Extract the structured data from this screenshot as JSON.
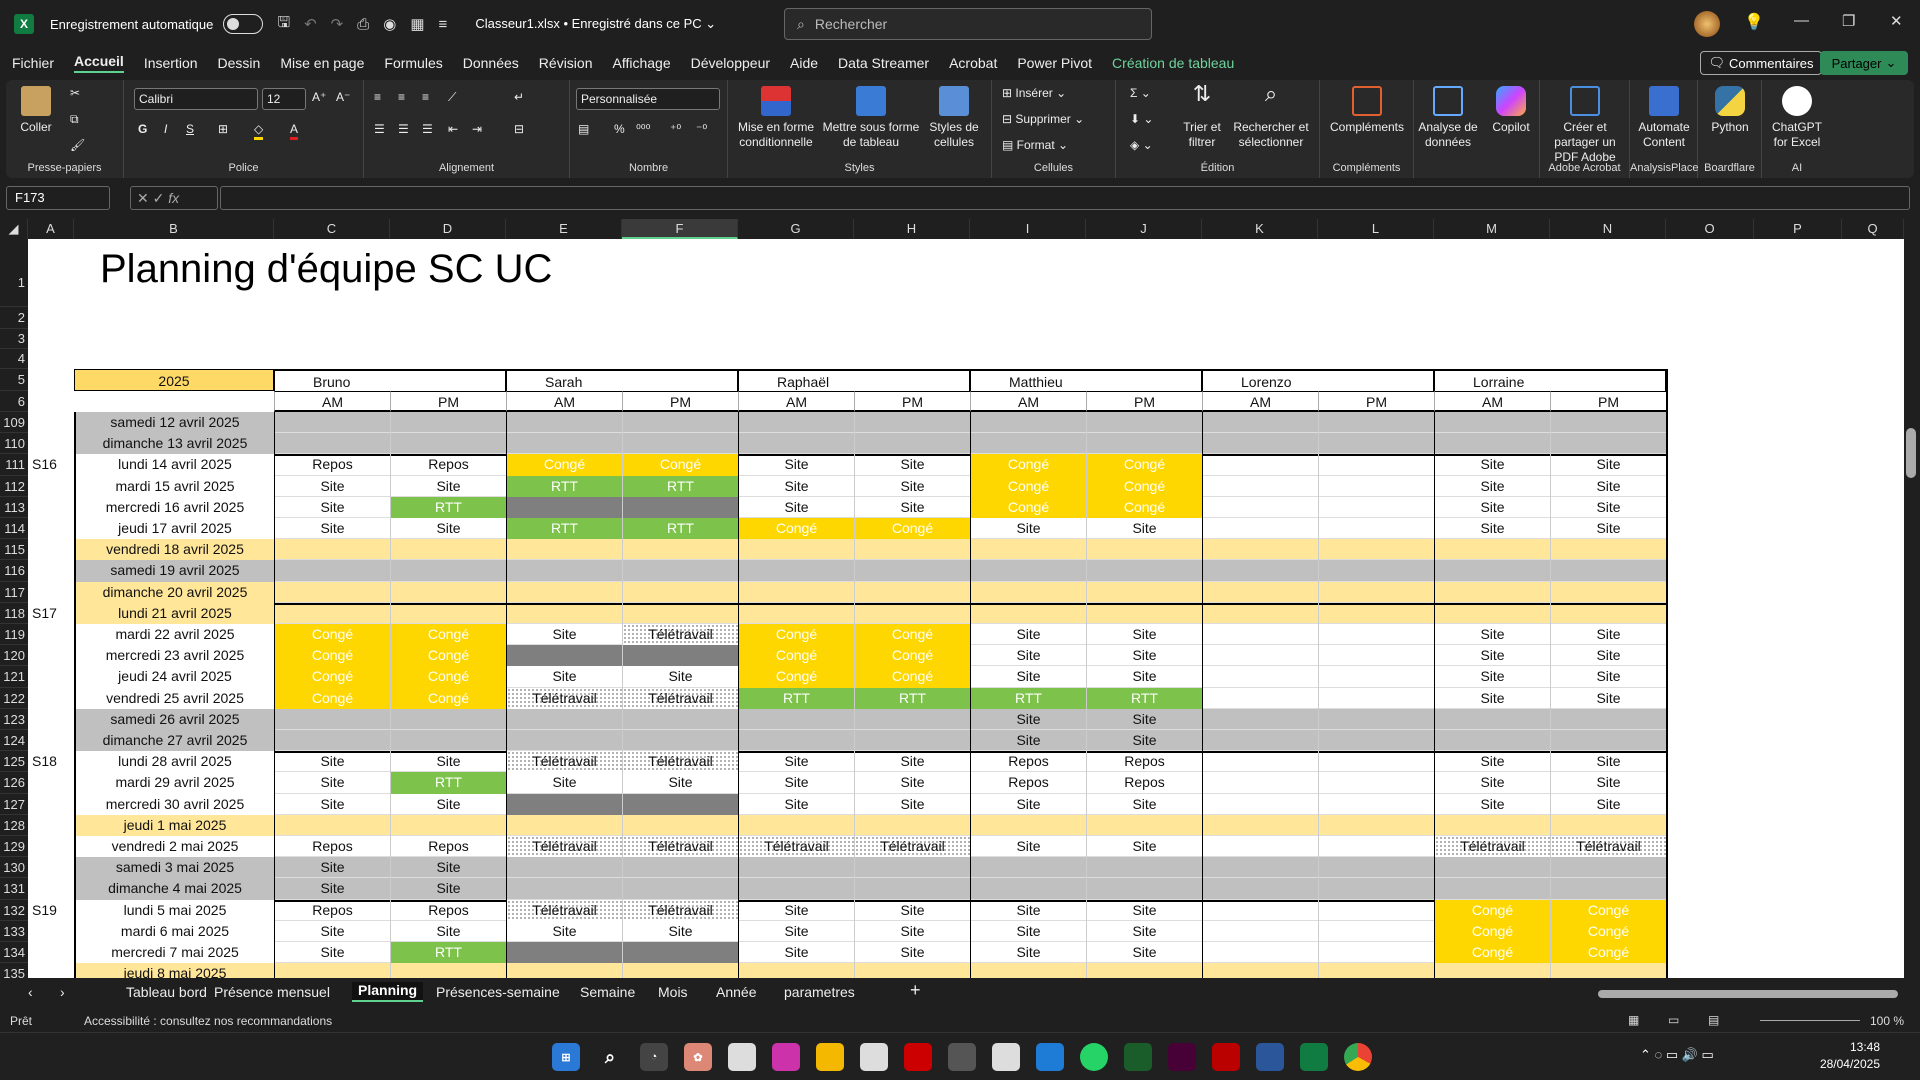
{
  "titlebar": {
    "app_icon": "X",
    "autosave_label": "Enregistrement automatique",
    "filename": "Classeur1.xlsx • Enregistré dans ce PC ⌄",
    "search_placeholder": "Rechercher"
  },
  "menu": [
    {
      "label": "Fichier"
    },
    {
      "label": "Accueil"
    },
    {
      "label": "Insertion"
    },
    {
      "label": "Dessin"
    },
    {
      "label": "Mise en page"
    },
    {
      "label": "Formules"
    },
    {
      "label": "Données"
    },
    {
      "label": "Révision"
    },
    {
      "label": "Affichage"
    },
    {
      "label": "Développeur"
    },
    {
      "label": "Aide"
    },
    {
      "label": "Data Streamer"
    },
    {
      "label": "Acrobat"
    },
    {
      "label": "Power Pivot"
    },
    {
      "label": "Création de tableau"
    }
  ],
  "header_buttons": {
    "comments": "Commentaires",
    "share": "Partager"
  },
  "ribbon": {
    "paste": "Coller",
    "font_name": "Calibri",
    "font_size": "12",
    "number_format": "Personnalisée",
    "groups": {
      "clipboard": "Presse-papiers",
      "font": "Police",
      "alignment": "Alignement",
      "number": "Nombre",
      "styles": "Styles",
      "cells": "Cellules",
      "editing": "Édition",
      "addins": "Compléments",
      "acrobat": "Adobe Acrobat",
      "analysisplace": "AnalysisPlace",
      "boardflare": "Boardflare",
      "ai": "AI"
    },
    "buttons": {
      "cond_format": "Mise en forme conditionnelle",
      "format_table": "Mettre sous forme de tableau",
      "cell_styles": "Styles de cellules",
      "insert": "Insérer",
      "delete": "Supprimer",
      "format": "Format",
      "sort_filter": "Trier et filtrer",
      "find_select": "Rechercher et sélectionner",
      "addins": "Compléments",
      "analyze": "Analyse de données",
      "copilot": "Copilot",
      "create_pdf": "Créer et partager un PDF Adobe",
      "automate": "Automate Content",
      "python": "Python",
      "chatgpt": "ChatGPT for Excel"
    }
  },
  "formula_bar": {
    "name_box": "F173",
    "fx": "fx",
    "content": ""
  },
  "columns": [
    "A",
    "B",
    "C",
    "D",
    "E",
    "F",
    "G",
    "H",
    "I",
    "J",
    "K",
    "L",
    "M",
    "N",
    "O",
    "P",
    "Q"
  ],
  "sheet": {
    "title": "Planning d'équipe SC   UC",
    "year": "2025",
    "people": [
      "Bruno",
      "Sarah",
      "Raphaël",
      "Matthieu",
      "Lorenzo",
      "Lorraine"
    ],
    "am": "AM",
    "pm": "PM",
    "rows": [
      {
        "n": "109",
        "wk": "",
        "day": "samedi 12 avril 2025",
        "t": "W",
        "c": []
      },
      {
        "n": "110",
        "wk": "",
        "day": "dimanche 13 avril 2025",
        "t": "W",
        "c": []
      },
      {
        "n": "111",
        "wk": "S16",
        "day": "lundi 14 avril 2025",
        "t": "N",
        "c": [
          "Repos",
          "Repos",
          "Congé",
          "Congé",
          "Site",
          "Site",
          "Congé",
          "Congé",
          "",
          "",
          "Site",
          "Site"
        ]
      },
      {
        "n": "112",
        "wk": "",
        "day": "mardi 15 avril 2025",
        "t": "N",
        "c": [
          "Site",
          "Site",
          "RTT",
          "RTT",
          "Site",
          "Site",
          "Congé",
          "Congé",
          "",
          "",
          "Site",
          "Site"
        ]
      },
      {
        "n": "113",
        "wk": "",
        "day": "mercredi 16 avril 2025",
        "t": "N",
        "c": [
          "Site",
          "RTT",
          "X",
          "X",
          "Site",
          "Site",
          "Congé",
          "Congé",
          "",
          "",
          "Site",
          "Site"
        ]
      },
      {
        "n": "114",
        "wk": "",
        "day": "jeudi 17 avril 2025",
        "t": "N",
        "c": [
          "Site",
          "Site",
          "RTT",
          "RTT",
          "Congé",
          "Congé",
          "Site",
          "Site",
          "",
          "",
          "Site",
          "Site"
        ]
      },
      {
        "n": "115",
        "wk": "",
        "day": "vendredi 18 avril 2025",
        "t": "H",
        "c": []
      },
      {
        "n": "116",
        "wk": "",
        "day": "samedi 19 avril 2025",
        "t": "W",
        "c": []
      },
      {
        "n": "117",
        "wk": "",
        "day": "dimanche 20 avril 2025",
        "t": "H",
        "c": []
      },
      {
        "n": "118",
        "wk": "S17",
        "day": "lundi 21 avril 2025",
        "t": "H",
        "c": []
      },
      {
        "n": "119",
        "wk": "",
        "day": "mardi 22 avril 2025",
        "t": "N",
        "c": [
          "Congé",
          "Congé",
          "Site",
          "Télétravail",
          "Congé",
          "Congé",
          "Site",
          "Site",
          "",
          "",
          "Site",
          "Site"
        ]
      },
      {
        "n": "120",
        "wk": "",
        "day": "mercredi 23 avril 2025",
        "t": "N",
        "c": [
          "Congé",
          "Congé",
          "X",
          "X",
          "Congé",
          "Congé",
          "Site",
          "Site",
          "",
          "",
          "Site",
          "Site"
        ]
      },
      {
        "n": "121",
        "wk": "",
        "day": "jeudi 24 avril 2025",
        "t": "N",
        "c": [
          "Congé",
          "Congé",
          "Site",
          "Site",
          "Congé",
          "Congé",
          "Site",
          "Site",
          "",
          "",
          "Site",
          "Site"
        ]
      },
      {
        "n": "122",
        "wk": "",
        "day": "vendredi 25 avril 2025",
        "t": "N",
        "c": [
          "Congé",
          "Congé",
          "Télétravail",
          "Télétravail",
          "RTT",
          "RTT",
          "RTT",
          "RTT",
          "",
          "",
          "Site",
          "Site"
        ]
      },
      {
        "n": "123",
        "wk": "",
        "day": "samedi 26 avril 2025",
        "t": "W",
        "c": [
          "",
          "",
          "",
          "",
          "",
          "",
          "Site",
          "Site",
          "",
          "",
          "",
          ""
        ]
      },
      {
        "n": "124",
        "wk": "",
        "day": "dimanche 27 avril 2025",
        "t": "W",
        "c": [
          "",
          "",
          "",
          "",
          "",
          "",
          "Site",
          "Site",
          "",
          "",
          "",
          ""
        ]
      },
      {
        "n": "125",
        "wk": "S18",
        "day": "lundi 28 avril 2025",
        "t": "N",
        "c": [
          "Site",
          "Site",
          "Télétravail",
          "Télétravail",
          "Site",
          "Site",
          "Repos",
          "Repos",
          "",
          "",
          "Site",
          "Site"
        ]
      },
      {
        "n": "126",
        "wk": "",
        "day": "mardi 29 avril 2025",
        "t": "N",
        "c": [
          "Site",
          "RTT",
          "Site",
          "Site",
          "Site",
          "Site",
          "Repos",
          "Repos",
          "",
          "",
          "Site",
          "Site"
        ]
      },
      {
        "n": "127",
        "wk": "",
        "day": "mercredi 30 avril 2025",
        "t": "N",
        "c": [
          "Site",
          "Site",
          "X",
          "X",
          "Site",
          "Site",
          "Site",
          "Site",
          "",
          "",
          "Site",
          "Site"
        ]
      },
      {
        "n": "128",
        "wk": "",
        "day": "jeudi 1 mai 2025",
        "t": "H",
        "c": []
      },
      {
        "n": "129",
        "wk": "",
        "day": "vendredi 2 mai 2025",
        "t": "N",
        "c": [
          "Repos",
          "Repos",
          "Télétravail",
          "Télétravail",
          "Télétravail",
          "Télétravail",
          "Site",
          "Site",
          "",
          "",
          "Télétravail",
          "Télétravail"
        ]
      },
      {
        "n": "130",
        "wk": "",
        "day": "samedi 3 mai 2025",
        "t": "W",
        "c": [
          "Site",
          "Site",
          "",
          "",
          "",
          "",
          "",
          "",
          "",
          "",
          "",
          ""
        ]
      },
      {
        "n": "131",
        "wk": "",
        "day": "dimanche 4 mai 2025",
        "t": "W",
        "c": [
          "Site",
          "Site",
          "",
          "",
          "",
          "",
          "",
          "",
          "",
          "",
          "",
          ""
        ]
      },
      {
        "n": "132",
        "wk": "S19",
        "day": "lundi 5 mai 2025",
        "t": "N",
        "c": [
          "Repos",
          "Repos",
          "Télétravail",
          "Télétravail",
          "Site",
          "Site",
          "Site",
          "Site",
          "",
          "",
          "Congé",
          "Congé"
        ]
      },
      {
        "n": "133",
        "wk": "",
        "day": "mardi 6 mai 2025",
        "t": "N",
        "c": [
          "Site",
          "Site",
          "Site",
          "Site",
          "Site",
          "Site",
          "Site",
          "Site",
          "",
          "",
          "Congé",
          "Congé"
        ]
      },
      {
        "n": "134",
        "wk": "",
        "day": "mercredi 7 mai 2025",
        "t": "N",
        "c": [
          "Site",
          "RTT",
          "X",
          "X",
          "Site",
          "Site",
          "Site",
          "Site",
          "",
          "",
          "Congé",
          "Congé"
        ]
      },
      {
        "n": "135",
        "wk": "",
        "day": "jeudi 8 mai 2025",
        "t": "H",
        "c": []
      }
    ]
  },
  "sheet_tabs": [
    "Tableau bord",
    "Présence mensuel",
    "Planning",
    "Présences-semaine",
    "Semaine",
    "Mois",
    "Année",
    "parametres"
  ],
  "active_tab": "Planning",
  "status": {
    "ready": "Prêt",
    "accessibility": "Accessibilité : consultez nos recommandations",
    "zoom": "100 %"
  },
  "clock": {
    "time": "13:48",
    "date": "28/04/2025"
  },
  "colors": {
    "conge": "#ffd700",
    "rtt": "#7dc24b",
    "weekend": "#c0c0c0",
    "holiday": "#ffe699",
    "unavail": "#7f7f7f",
    "header_year": "#ffd966"
  }
}
